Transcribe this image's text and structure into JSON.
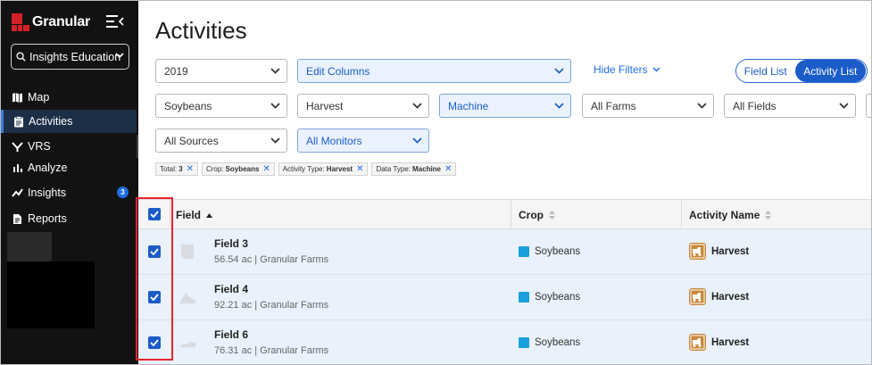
{
  "sidebar": {
    "logo": "Granular",
    "workspace": "Insights Education",
    "nav": [
      {
        "label": "Map",
        "icon": "map-icon"
      },
      {
        "label": "Activities",
        "icon": "clipboard-icon",
        "active": true
      },
      {
        "label": "VRS",
        "icon": "vrs-icon"
      },
      {
        "label": "Analyze",
        "icon": "bar-chart-icon"
      },
      {
        "label": "Insights",
        "icon": "trend-icon",
        "badge": "3"
      },
      {
        "label": "Reports",
        "icon": "report-icon"
      }
    ]
  },
  "main": {
    "title": "Activities",
    "filters": {
      "year": "2019",
      "edit_columns": "Edit Columns",
      "hide_filters": "Hide Filters",
      "crop": "Soybeans",
      "activity_type": "Harvest",
      "data_type": "Machine",
      "farms": "All Farms",
      "fields": "All Fields",
      "sources": "All Sources",
      "monitors": "All Monitors"
    },
    "view_toggle": {
      "field_list": "Field List",
      "activity_list": "Activity List"
    },
    "chips": [
      {
        "key": "Total:",
        "value": "3"
      },
      {
        "key": "Crop:",
        "value": "Soybeans"
      },
      {
        "key": "Activity Type:",
        "value": "Harvest"
      },
      {
        "key": "Data Type:",
        "value": "Machine"
      }
    ],
    "table": {
      "columns": [
        "Field",
        "Crop",
        "Activity Name"
      ],
      "rows": [
        {
          "field": "Field 3",
          "meta": "56.54 ac | Granular Farms",
          "crop": "Soybeans",
          "activity": "Harvest"
        },
        {
          "field": "Field 4",
          "meta": "92.21 ac | Granular Farms",
          "crop": "Soybeans",
          "activity": "Harvest"
        },
        {
          "field": "Field 6",
          "meta": "76.31 ac | Granular Farms",
          "crop": "Soybeans",
          "activity": "Harvest"
        }
      ]
    }
  },
  "colors": {
    "accent": "#1b5cc9",
    "brand_red": "#d41f26",
    "crop_soybeans": "#1aa0de",
    "harvest": "#c9883a",
    "highlight": "#e8232f"
  }
}
